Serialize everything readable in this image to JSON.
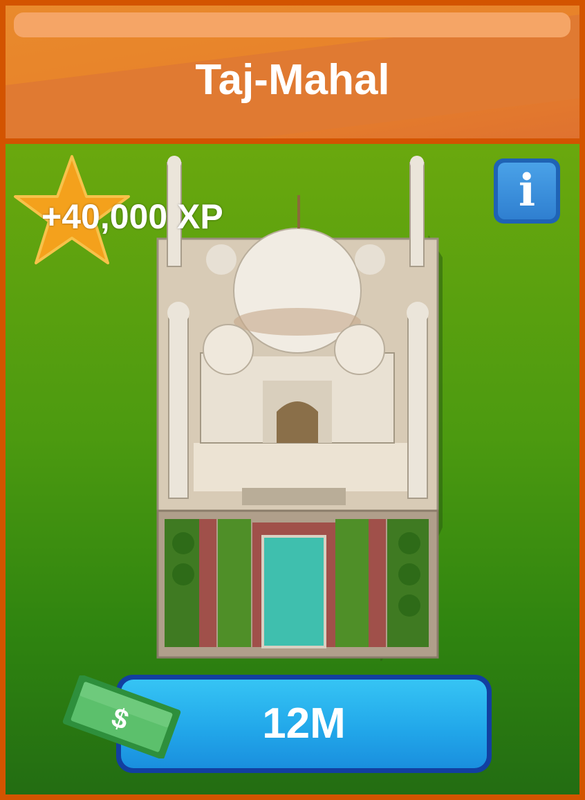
{
  "header": {
    "title": "Taj-Mahal"
  },
  "reward": {
    "xp_label": "+40,000 XP"
  },
  "info_button": {
    "glyph": "i"
  },
  "purchase": {
    "price": "12M",
    "currency_symbol": "$"
  },
  "colors": {
    "header": "#e98a2c",
    "frame": "#d35400",
    "panel_green": "#4c9a10",
    "button_blue": "#22a8ea",
    "star": "#f4a11c"
  }
}
